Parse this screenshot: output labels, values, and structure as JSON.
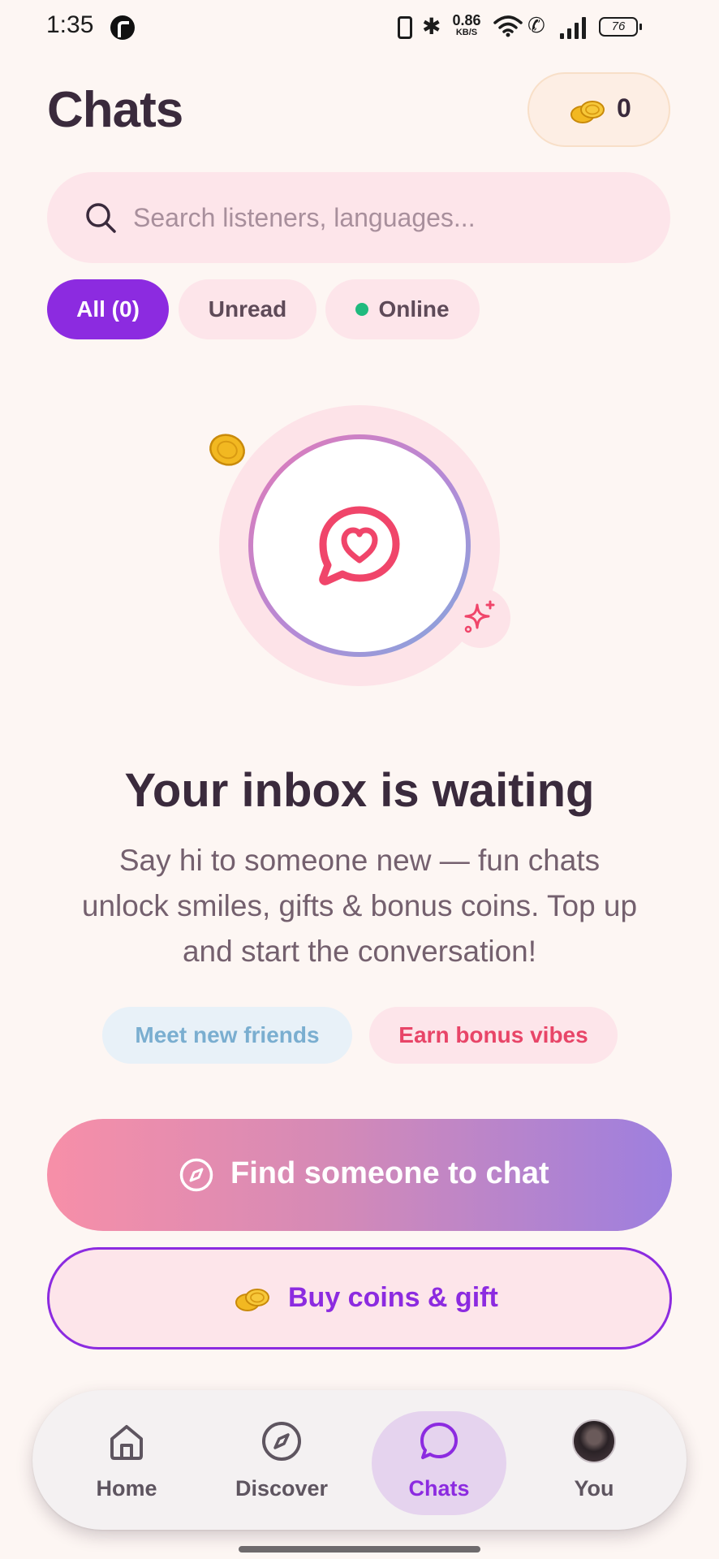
{
  "status_bar": {
    "time": "1:35",
    "net_speed_value": "0.86",
    "net_speed_unit": "KB/S",
    "battery": "76"
  },
  "header": {
    "title": "Chats",
    "coin_balance": "0"
  },
  "search": {
    "placeholder": "Search listeners, languages..."
  },
  "filters": {
    "all": "All (0)",
    "unread": "Unread",
    "online": "Online"
  },
  "empty_state": {
    "title": "Your inbox is waiting",
    "description": "Say hi to someone new — fun chats unlock smiles, gifts & bonus coins. Top up and start the conversation!",
    "tags": [
      "Meet new friends",
      "Earn bonus vibes"
    ]
  },
  "actions": {
    "find_label": "Find someone to chat",
    "buy_label": "Buy coins & gift"
  },
  "bottom_nav": {
    "items": [
      {
        "label": "Home",
        "icon": "home-icon"
      },
      {
        "label": "Discover",
        "icon": "compass-icon"
      },
      {
        "label": "Chats",
        "icon": "chat-bubble-icon",
        "active": true
      },
      {
        "label": "You",
        "icon": "avatar"
      }
    ]
  },
  "colors": {
    "accent": "#8c2be0",
    "background": "#fdf6f3",
    "pink_surface": "#fde5ea",
    "online_green": "#1fba7e",
    "heart_red": "#f0456a"
  }
}
